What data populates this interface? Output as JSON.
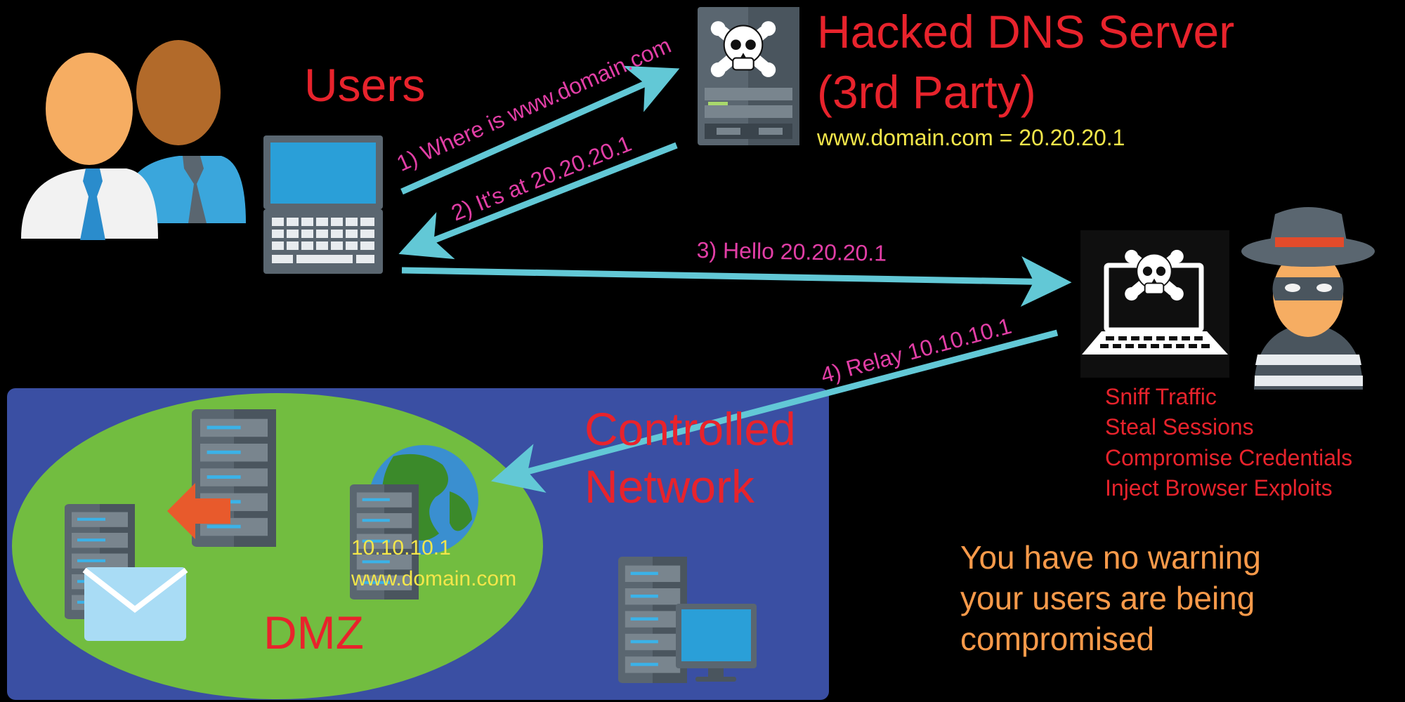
{
  "labels": {
    "users": "Users",
    "dns_title_line1": "Hacked DNS Server",
    "dns_title_line2": "(3rd Party)",
    "dns_record": "www.domain.com = 20.20.20.1",
    "controlled_line1": "Controlled",
    "controlled_line2": "Network",
    "dmz": "DMZ",
    "server_ip": "10.10.10.1",
    "server_domain": "www.domain.com"
  },
  "steps": [
    "1) Where is www.domain.com",
    "2) It's at 20.20.20.1",
    "3) Hello 20.20.20.1",
    "4) Relay 10.10.10.1"
  ],
  "attacker_actions": [
    "Sniff Traffic",
    "Steal Sessions",
    "Compromise Credentials",
    "Inject Browser Exploits"
  ],
  "warning": {
    "line1": "You have no warning",
    "line2": "your users are being",
    "line3": "compromised"
  },
  "colors": {
    "background": "#000000",
    "arrow": "#62c8d6",
    "title_red": "#e8232c",
    "step_magenta": "#e23ea6",
    "record_yellow": "#f3e64a",
    "warning_orange": "#f99a4a",
    "network_blue": "#3a4fa3",
    "dmz_green": "#72bd40"
  },
  "icons": {
    "users": "users-icon",
    "laptop": "laptop-icon",
    "dns_server": "hacked-server-icon",
    "hacked_laptop": "hacked-laptop-icon",
    "hacker": "hacker-icon",
    "servers": "server-icon",
    "globe": "globe-icon",
    "mail": "mail-icon",
    "monitor": "monitor-icon"
  }
}
